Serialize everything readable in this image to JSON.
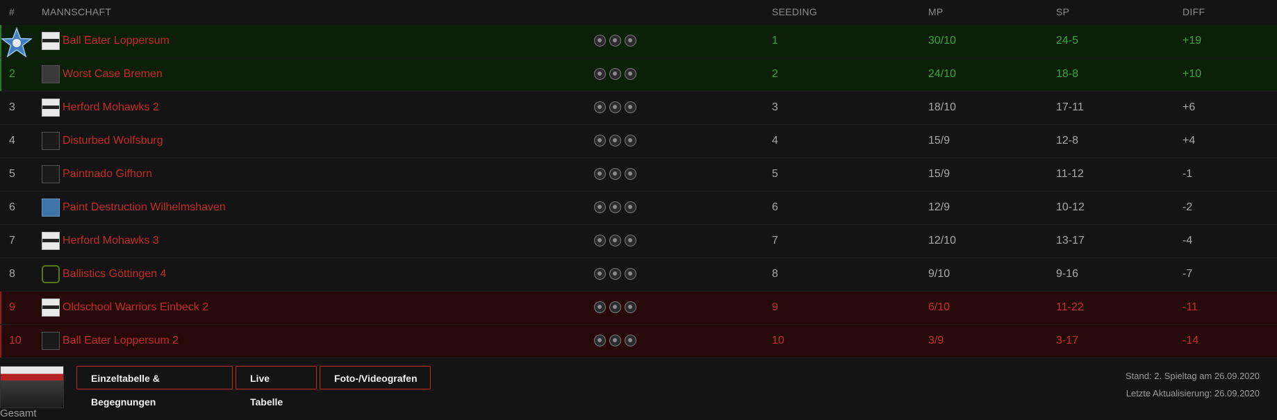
{
  "table": {
    "headers": {
      "rank": "#",
      "team": "MANNSCHAFT",
      "seeding": "SEEDING",
      "mp": "MP",
      "sp": "SP",
      "diff": "DIFF"
    },
    "rows": [
      {
        "rank": "",
        "team": "Ball Eater Loppersum",
        "seeding": "1",
        "mp": "30/10",
        "sp": "24-5",
        "diff": "+19",
        "zone": "green",
        "logo": "white"
      },
      {
        "rank": "2",
        "team": "Worst Case Bremen",
        "seeding": "2",
        "mp": "24/10",
        "sp": "18-8",
        "diff": "+10",
        "zone": "green",
        "logo": "grey"
      },
      {
        "rank": "3",
        "team": "Herford Mohawks 2",
        "seeding": "3",
        "mp": "18/10",
        "sp": "17-11",
        "diff": "+6",
        "zone": "plain",
        "logo": "white"
      },
      {
        "rank": "4",
        "team": "Disturbed Wolfsburg",
        "seeding": "4",
        "mp": "15/9",
        "sp": "12-8",
        "diff": "+4",
        "zone": "plain",
        "logo": "dark"
      },
      {
        "rank": "5",
        "team": "Paintnado Gifhorn",
        "seeding": "5",
        "mp": "15/9",
        "sp": "11-12",
        "diff": "-1",
        "zone": "plain",
        "logo": "dark"
      },
      {
        "rank": "6",
        "team": "Paint Destruction Wilhelmshaven",
        "seeding": "6",
        "mp": "12/9",
        "sp": "10-12",
        "diff": "-2",
        "zone": "plain",
        "logo": "blue"
      },
      {
        "rank": "7",
        "team": "Herford Mohawks 3",
        "seeding": "7",
        "mp": "12/10",
        "sp": "13-17",
        "diff": "-4",
        "zone": "plain",
        "logo": "white"
      },
      {
        "rank": "8",
        "team": "Ballistics Göttingen 4",
        "seeding": "8",
        "mp": "9/10",
        "sp": "9-16",
        "diff": "-7",
        "zone": "plain",
        "logo": "green"
      },
      {
        "rank": "9",
        "team": "Oldschool Warriors Einbeck 2",
        "seeding": "9",
        "mp": "6/10",
        "sp": "11-22",
        "diff": "-11",
        "zone": "red",
        "logo": "white"
      },
      {
        "rank": "10",
        "team": "Ball Eater Loppersum 2",
        "seeding": "10",
        "mp": "3/9",
        "sp": "3-17",
        "diff": "-14",
        "zone": "red",
        "logo": "dark"
      }
    ],
    "row_icons": [
      "history-icon",
      "team-icon",
      "bird-icon"
    ]
  },
  "footer": {
    "thumbnail_label": "Gesamt",
    "buttons": [
      "Einzeltabelle & Begegnungen",
      "Live Tabelle",
      "Foto-/Videografen"
    ],
    "stand": "Stand: 2. Spieltag am 26.09.2020",
    "updated": "Letzte Aktualisierung: 26.09.2020"
  },
  "colors": {
    "background": "#141414",
    "promotion": "#0c1f08",
    "promotion_text": "#3aa63a",
    "relegation": "#260a0a",
    "relegation_text": "#c62d2d",
    "team_link": "#c22b2b",
    "button_border": "#c22b2b"
  }
}
